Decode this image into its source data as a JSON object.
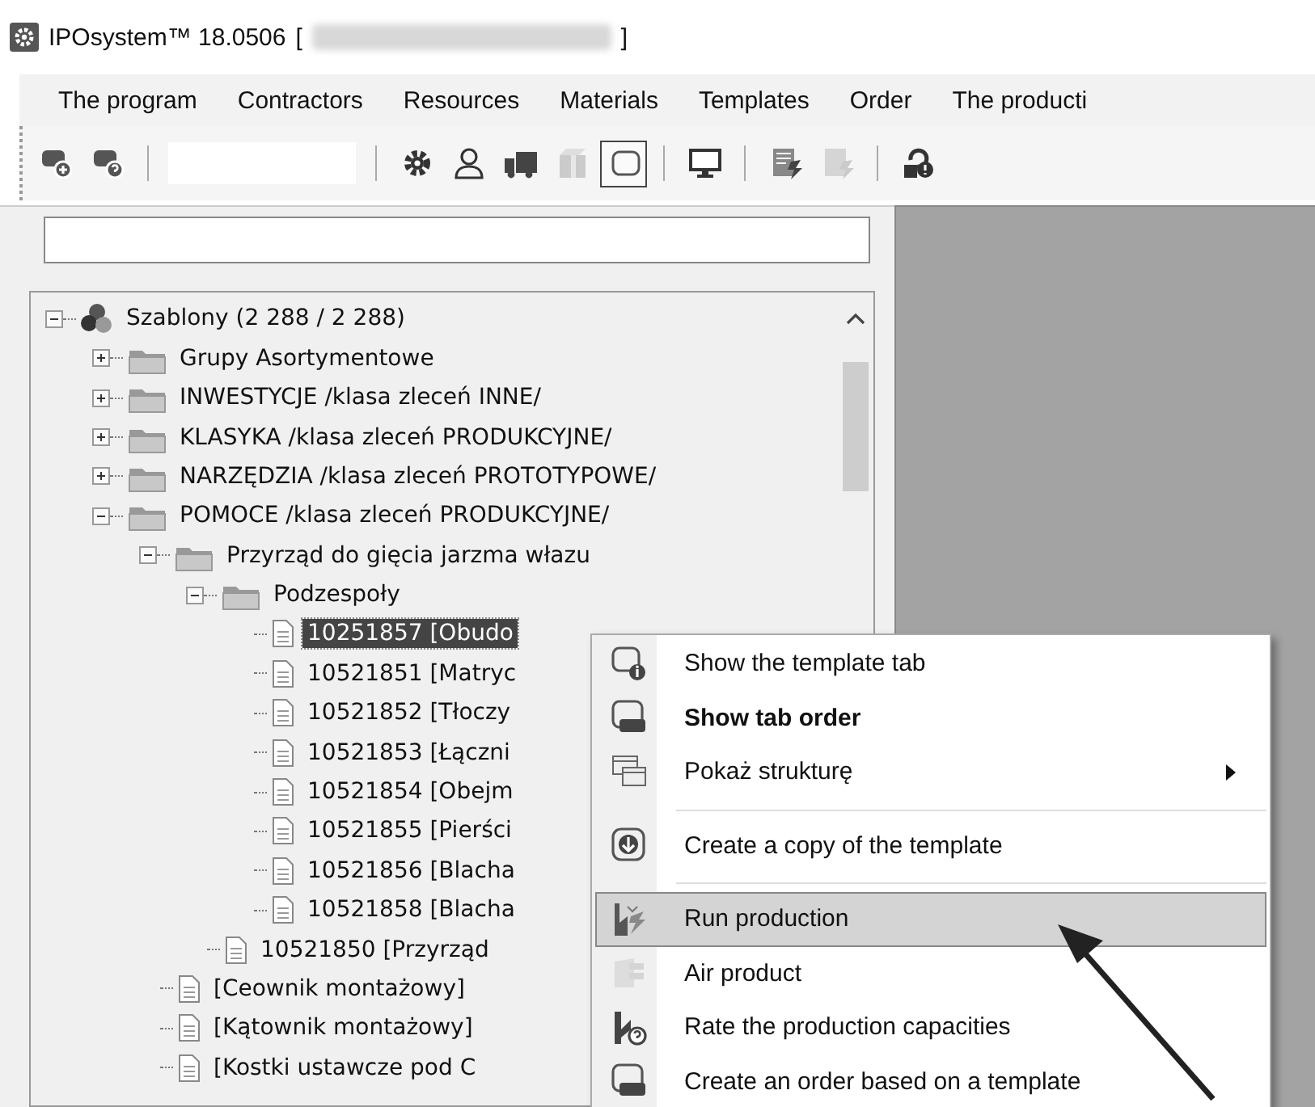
{
  "window": {
    "title": "IPOsystem™ 18.0506",
    "title_open": "[",
    "title_close": "]"
  },
  "menu_bar": [
    "The program",
    "Contractors",
    "Resources",
    "Materials",
    "Templates",
    "Order",
    "The producti"
  ],
  "toolbar": [
    {
      "kind": "button",
      "disabled": false,
      "selected": false
    },
    {
      "kind": "button",
      "disabled": false,
      "selected": false
    },
    {
      "kind": "separator"
    },
    {
      "kind": "field"
    },
    {
      "kind": "separator"
    },
    {
      "kind": "button",
      "disabled": false,
      "selected": false
    },
    {
      "kind": "button",
      "disabled": false,
      "selected": false
    },
    {
      "kind": "button",
      "disabled": false,
      "selected": false
    },
    {
      "kind": "button",
      "disabled": true,
      "selected": false
    },
    {
      "kind": "button",
      "disabled": false,
      "selected": true
    },
    {
      "kind": "separator"
    },
    {
      "kind": "button",
      "disabled": false,
      "selected": false
    },
    {
      "kind": "separator"
    },
    {
      "kind": "button",
      "disabled": false,
      "selected": false
    },
    {
      "kind": "button",
      "disabled": true,
      "selected": false
    },
    {
      "kind": "separator"
    },
    {
      "kind": "button",
      "disabled": false,
      "selected": false
    }
  ],
  "tree": [
    {
      "kind": "root",
      "label": "Szablony (2 288 / 2 288)",
      "expanded": true,
      "selected": false,
      "children": [
        {
          "kind": "folder",
          "label": "Grupy Asortymentowe",
          "expanded": false,
          "selected": false
        },
        {
          "kind": "folder",
          "label": "INWESTYCJE /klasa zleceń INNE/",
          "expanded": false,
          "selected": false
        },
        {
          "kind": "folder",
          "label": "KLASYKA /klasa zleceń PRODUKCYJNE/",
          "expanded": false,
          "selected": false
        },
        {
          "kind": "folder",
          "label": "NARZĘDZIA /klasa zleceń PROTOTYPOWE/",
          "expanded": false,
          "selected": false
        },
        {
          "kind": "folder",
          "label": "POMOCE /klasa zleceń PRODUKCYJNE/",
          "expanded": true,
          "selected": false,
          "children": [
            {
              "kind": "folder",
              "label": "Przyrząd do gięcia jarzma włazu",
              "expanded": true,
              "selected": false,
              "children": [
                {
                  "kind": "folder",
                  "label": "Podzespoły",
                  "expanded": true,
                  "selected": false,
                  "children": [
                    {
                      "kind": "document",
                      "label": "10251857 [Obudo",
                      "selected": true
                    },
                    {
                      "kind": "document",
                      "label": "10521851 [Matryc",
                      "selected": false
                    },
                    {
                      "kind": "document",
                      "label": "10521852 [Tłoczy",
                      "selected": false
                    },
                    {
                      "kind": "document",
                      "label": "10521853 [Łączni",
                      "selected": false
                    },
                    {
                      "kind": "document",
                      "label": "10521854 [Obejm",
                      "selected": false
                    },
                    {
                      "kind": "document",
                      "label": "10521855 [Pierści",
                      "selected": false
                    },
                    {
                      "kind": "document",
                      "label": "10521856 [Blacha",
                      "selected": false
                    },
                    {
                      "kind": "document",
                      "label": "10521858 [Blacha",
                      "selected": false
                    }
                  ]
                },
                {
                  "kind": "document",
                  "label": "10521850 [Przyrząd",
                  "selected": false
                }
              ]
            },
            {
              "kind": "document",
              "label": "[Ceownik montażowy]",
              "selected": false
            },
            {
              "kind": "document",
              "label": "[Kątownik montażowy]",
              "selected": false
            },
            {
              "kind": "document",
              "label": "[Kostki ustawcze pod C",
              "selected": false
            }
          ]
        }
      ]
    }
  ],
  "context_menu": [
    {
      "kind": "item",
      "label": "Show the template tab",
      "default": false,
      "submenu": false,
      "selected": false,
      "disabled": false
    },
    {
      "kind": "item",
      "label": "Show tab order",
      "default": true,
      "submenu": false,
      "selected": false,
      "disabled": false
    },
    {
      "kind": "item",
      "label": "Pokaż strukturę",
      "default": false,
      "submenu": true,
      "selected": false,
      "disabled": false
    },
    {
      "kind": "separator"
    },
    {
      "kind": "item",
      "label": "Create a copy of the template",
      "default": false,
      "submenu": false,
      "selected": false,
      "disabled": false
    },
    {
      "kind": "separator"
    },
    {
      "kind": "item",
      "label": "Run production",
      "default": false,
      "submenu": false,
      "selected": true,
      "disabled": false
    },
    {
      "kind": "item",
      "label": "Air product",
      "default": false,
      "submenu": false,
      "selected": false,
      "disabled": true
    },
    {
      "kind": "item",
      "label": "Rate the production capacities",
      "default": false,
      "submenu": false,
      "selected": false,
      "disabled": false
    },
    {
      "kind": "item",
      "label": "Create an order based on a template",
      "default": false,
      "submenu": false,
      "selected": false,
      "disabled": false
    }
  ]
}
